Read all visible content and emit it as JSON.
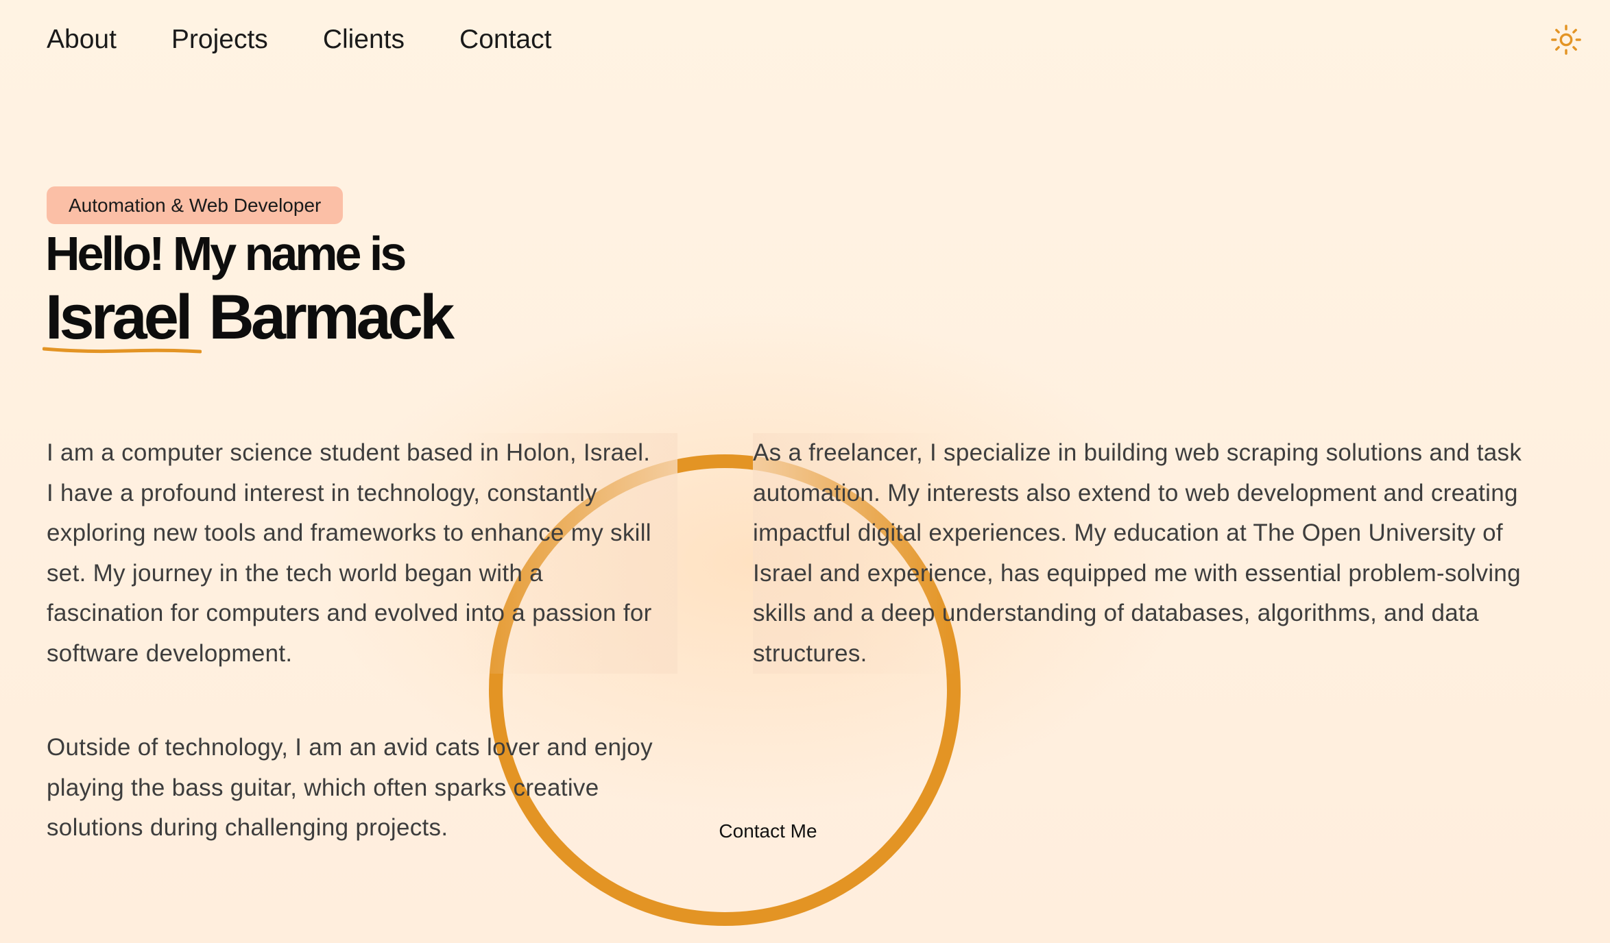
{
  "nav": {
    "items": [
      "About",
      "Projects",
      "Clients",
      "Contact"
    ]
  },
  "theme_toggle": {
    "icon": "sun-icon",
    "color": "#e39424"
  },
  "hero": {
    "badge": "Automation & Web Developer",
    "greeting": "Hello! My name is",
    "first_name": "Israel",
    "last_name": "Barmack"
  },
  "about": {
    "para1": "I am a computer science student based in Holon, Israel. I have a profound interest in technology, constantly exploring new tools and frameworks to enhance my skill set. My journey in the tech world began with a fascination for computers and evolved into a passion for software development.",
    "para2": "As a freelancer, I specialize in building web scraping solutions and task automation. My interests also extend to web development and creating impactful digital experiences. My education at The Open University of Israel and experience, has equipped me with essential problem-solving skills and a deep understanding of databases, algorithms, and data structures.",
    "para3": "Outside of technology, I am an avid cats lover and enjoy playing the bass guitar, which often sparks creative solutions during challenging projects."
  },
  "cta": {
    "label": "Contact Me"
  },
  "colors": {
    "accent": "#e39424",
    "badge_bg": "#fbbfa6",
    "background": "#fef3e2"
  }
}
